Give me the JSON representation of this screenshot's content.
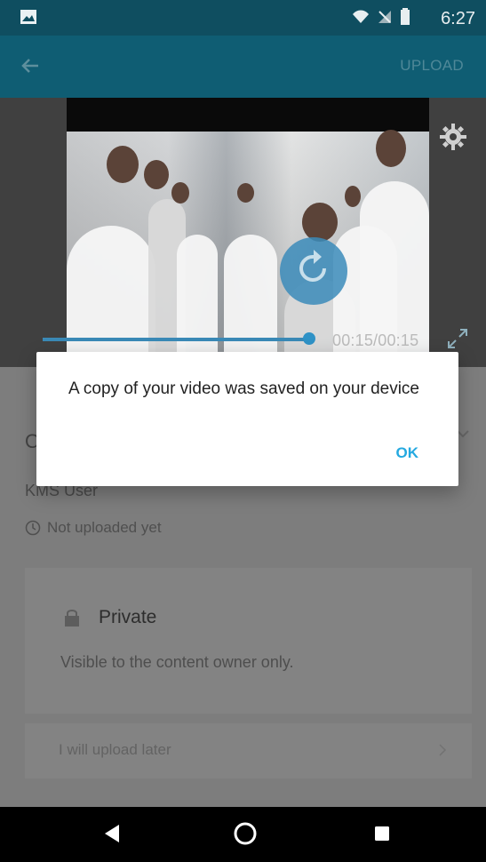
{
  "status_bar": {
    "time": "6:27"
  },
  "app_bar": {
    "upload_label": "UPLOAD"
  },
  "video": {
    "time_readout": "00:15/00:15",
    "progress": 1.0
  },
  "details": {
    "partial_title_visible": "O",
    "owner_name": "KMS User",
    "upload_status": "Not uploaded yet",
    "privacy_title": "Private",
    "privacy_description": "Visible to the content owner only.",
    "upload_later_label": "I will upload later"
  },
  "dialog": {
    "message": "A copy of your video was saved on your device",
    "ok_label": "OK"
  },
  "colors": {
    "status_bar": "#0f4e60",
    "app_bar": "#0f5d73",
    "accent": "#24a9e0",
    "overlay_gray": "#7d7d7d",
    "video_control": "#3a89b6"
  },
  "icons": [
    "gallery-icon",
    "back-arrow-icon",
    "gear-icon",
    "replay-icon",
    "fullscreen-icon",
    "clock-icon",
    "lock-icon",
    "chevron-right-icon",
    "nav-back-icon",
    "nav-home-icon",
    "nav-recents-icon"
  ]
}
